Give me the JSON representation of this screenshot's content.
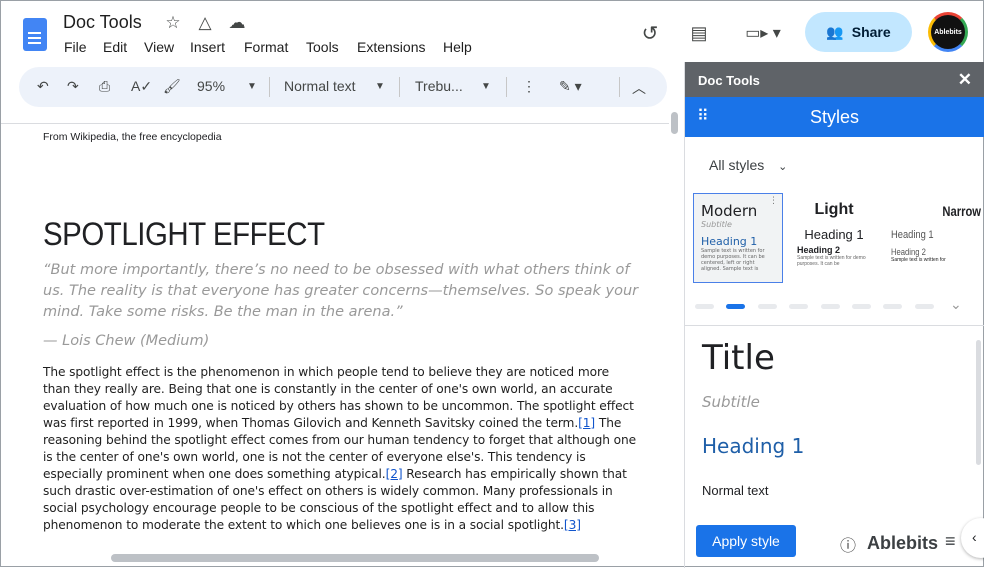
{
  "app": {
    "title": "Doc Tools",
    "menu": [
      "File",
      "Edit",
      "View",
      "Insert",
      "Format",
      "Tools",
      "Extensions",
      "Help"
    ],
    "share_label": "Share",
    "avatar_text": "Ablebits"
  },
  "toolbar": {
    "zoom": "95%",
    "style": "Normal text",
    "font": "Trebu..."
  },
  "doc": {
    "source": "From Wikipedia, the free encyclopedia",
    "heading": "SPOTLIGHT EFFECT",
    "quote": "“But more importantly, there’s no need to be obsessed with what others think of us. The reality is that everyone has greater concerns—themselves. So speak your mind. Take some risks. Be the man in the arena.”",
    "attribution": "— Lois Chew (Medium)",
    "body1": "The spotlight effect is the phenomenon in which people tend to believe they are noticed more than they really are. Being that one is constantly in the center of one's own world, an accurate evaluation of how much one is noticed by others has shown to be uncommon. The spotlight effect was first reported in 1999, when Thomas Gilovich and Kenneth Savitsky coined the term.",
    "ref1": "[1]",
    "body2": " The reasoning behind the spotlight effect comes from our human tendency to forget that although one is the center of one's own world, one is not the center of everyone else's. This tendency is especially prominent when one does something atypical.",
    "ref2": "[2]",
    "body3": " Research has empirically shown that such drastic over-estimation of one's effect on others is widely common. Many professionals in social psychology encourage people to be conscious of the spotlight effect and to allow this phenomenon to moderate the extent to which one believes one is in a social spotlight.",
    "ref3": "[3]"
  },
  "panel": {
    "header": "Doc Tools",
    "title": "Styles",
    "filter": "All styles",
    "cards": [
      {
        "name": "Modern",
        "subtitle": "Subtitle",
        "h1": "Heading 1",
        "sample": "Sample text is written for demo purposes. It can be centered, left or right aligned. Sample text is"
      },
      {
        "name": "Light",
        "h1": "Heading 1",
        "h2": "Heading 2",
        "sample": "Sample text is written for demo purposes. It can be"
      },
      {
        "name": "Narrow",
        "h1": "Heading 1",
        "h2": "Heading 2",
        "sample": "Sample text is written for"
      }
    ],
    "carousel_active": 2,
    "carousel_count": 8,
    "preview": {
      "title": "Title",
      "subtitle": "Subtitle",
      "h1": "Heading 1",
      "normal": "Normal text"
    },
    "apply_label": "Apply style",
    "brand": "Ablebits"
  },
  "colors": {
    "accent": "#1a73e8",
    "heading": "#1f5fa8",
    "share_bg": "#c2e7ff"
  }
}
